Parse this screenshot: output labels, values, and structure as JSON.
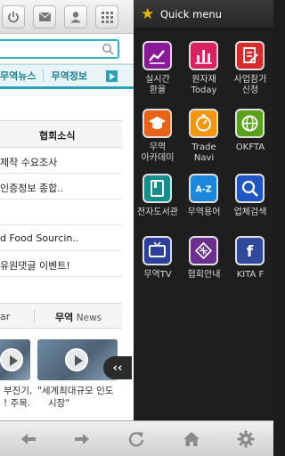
{
  "page": {
    "tabs": [
      "무역뉴스",
      "무역정보"
    ],
    "notice_header": "협회소식",
    "notice_items": [
      "제작 수요조사",
      "인증정보 종합..",
      "",
      "d Food Sourcin..",
      "유원댓글 이벤트!"
    ],
    "media_left_label": "ar",
    "media_header_bold": "무역",
    "media_header_light": "News",
    "captions": {
      "left_line1": "부진기,",
      "left_line2": "! 주목.",
      "right_line1": "\"세계최대규모 인도",
      "right_line2": "시장\""
    }
  },
  "drawer": {
    "title": "Quick menu",
    "items": [
      {
        "label": "실시간\n환율",
        "icon": "exchange-rate-chart-icon",
        "color": "#8a1a97"
      },
      {
        "label": "원자재\nToday",
        "icon": "raw-material-bar-chart-icon",
        "color": "#d7245f"
      },
      {
        "label": "사업참가\n신청",
        "icon": "application-form-icon",
        "color": "#d82b2b"
      },
      {
        "label": "무역\n아카데미",
        "icon": "graduation-cap-icon",
        "color": "#e8631a"
      },
      {
        "label": "Trade\nNavi",
        "icon": "compass-icon",
        "color": "#f0960f"
      },
      {
        "label": "OKFTA",
        "icon": "globe-icon",
        "color": "#5aa21b"
      },
      {
        "label": "전자도서관",
        "icon": "book-icon",
        "color": "#168f8c"
      },
      {
        "label": "무역용어",
        "icon": "a-to-z-icon",
        "color": "#1d87dc"
      },
      {
        "label": "업체검색",
        "icon": "search-company-icon",
        "color": "#1f56c4"
      },
      {
        "label": "무역TV",
        "icon": "tv-icon",
        "color": "#2d3f9c"
      },
      {
        "label": "협회안내",
        "icon": "association-logo-icon",
        "color": "#6b2f8e"
      },
      {
        "label": "KITA F",
        "icon": "facebook-icon",
        "color": "#2f4a9a"
      }
    ]
  },
  "drawer_handle": "‹‹"
}
